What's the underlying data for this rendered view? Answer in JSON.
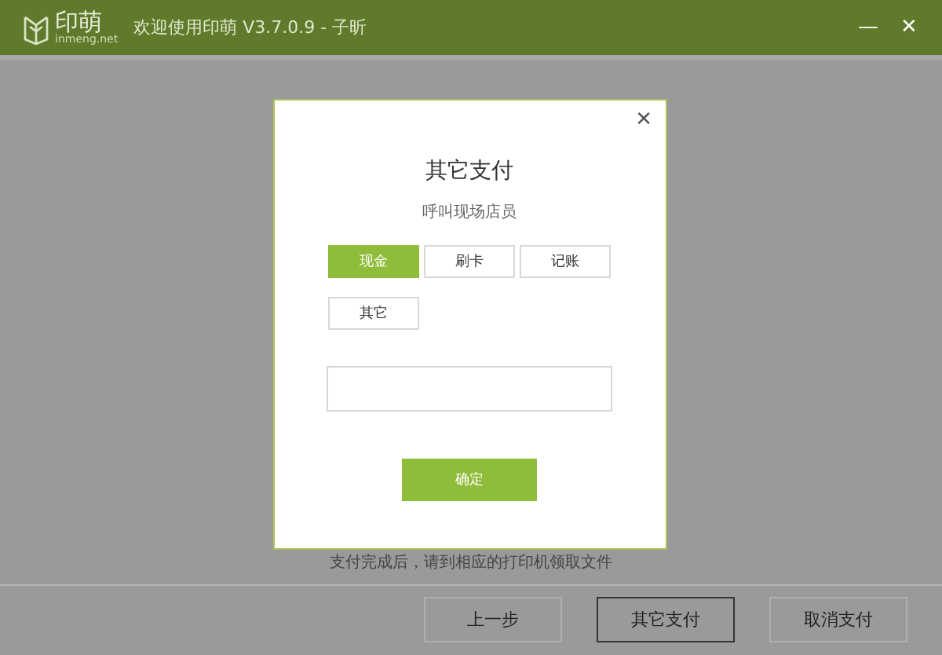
{
  "window": {
    "logo_text": "印萌",
    "logo_sub": "inmeng.net",
    "title": "欢迎使用印萌 V3.7.0.9 - 子昕",
    "controls": [
      "—",
      "✕"
    ]
  },
  "background": {
    "hint": "支付完成后，请到相应的打印机领取文件"
  },
  "dialog": {
    "close": "✕",
    "title": "其它支付",
    "subtitle": "呼叫现场店员",
    "options": [
      {
        "label": "现金",
        "selected": true
      },
      {
        "label": "刷卡",
        "selected": false
      },
      {
        "label": "记账",
        "selected": false
      },
      {
        "label": "其它",
        "selected": false
      }
    ],
    "confirm": "确定"
  },
  "footer": {
    "buttons": [
      {
        "label": "上一步",
        "selected": false
      },
      {
        "label": "其它支付",
        "selected": true
      },
      {
        "label": "取消支付",
        "selected": false
      }
    ]
  }
}
